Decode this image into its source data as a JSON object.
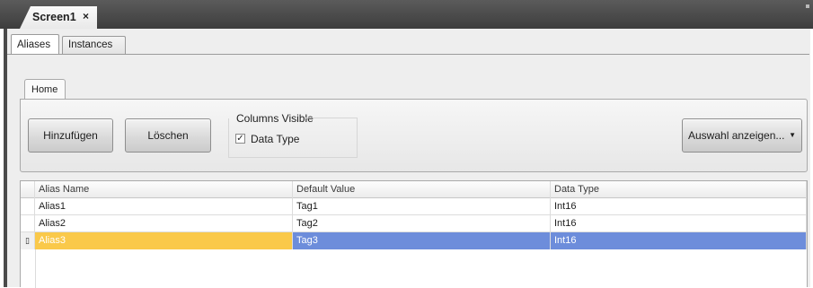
{
  "document_tab": {
    "title": "Screen1",
    "close_glyph": "×"
  },
  "tabs": [
    {
      "label": "Aliases",
      "active": true
    },
    {
      "label": "Instances",
      "active": false
    }
  ],
  "ribbon": {
    "tab_label": "Home",
    "add_label": "Hinzufügen",
    "delete_label": "Löschen",
    "columns_group_title": "Columns Visible",
    "data_type_checkbox": {
      "label": "Data Type",
      "checked": true
    },
    "show_selection_label": "Auswahl anzeigen...",
    "show_selection_arrow": "▼"
  },
  "grid": {
    "columns": [
      "Alias Name",
      "Default Value",
      "Data Type"
    ],
    "rows": [
      {
        "alias": "Alias1",
        "default": "Tag1",
        "type": "Int16",
        "selected": false
      },
      {
        "alias": "Alias2",
        "default": "Tag2",
        "type": "Int16",
        "selected": false
      },
      {
        "alias": "Alias3",
        "default": "Tag3",
        "type": "Int16",
        "selected": true
      }
    ],
    "edit_indicator": "▯"
  },
  "colors": {
    "selection_primary": "#fac94a",
    "selection_secondary": "#6d8ddb",
    "header_strip": "#4a4a4a"
  }
}
